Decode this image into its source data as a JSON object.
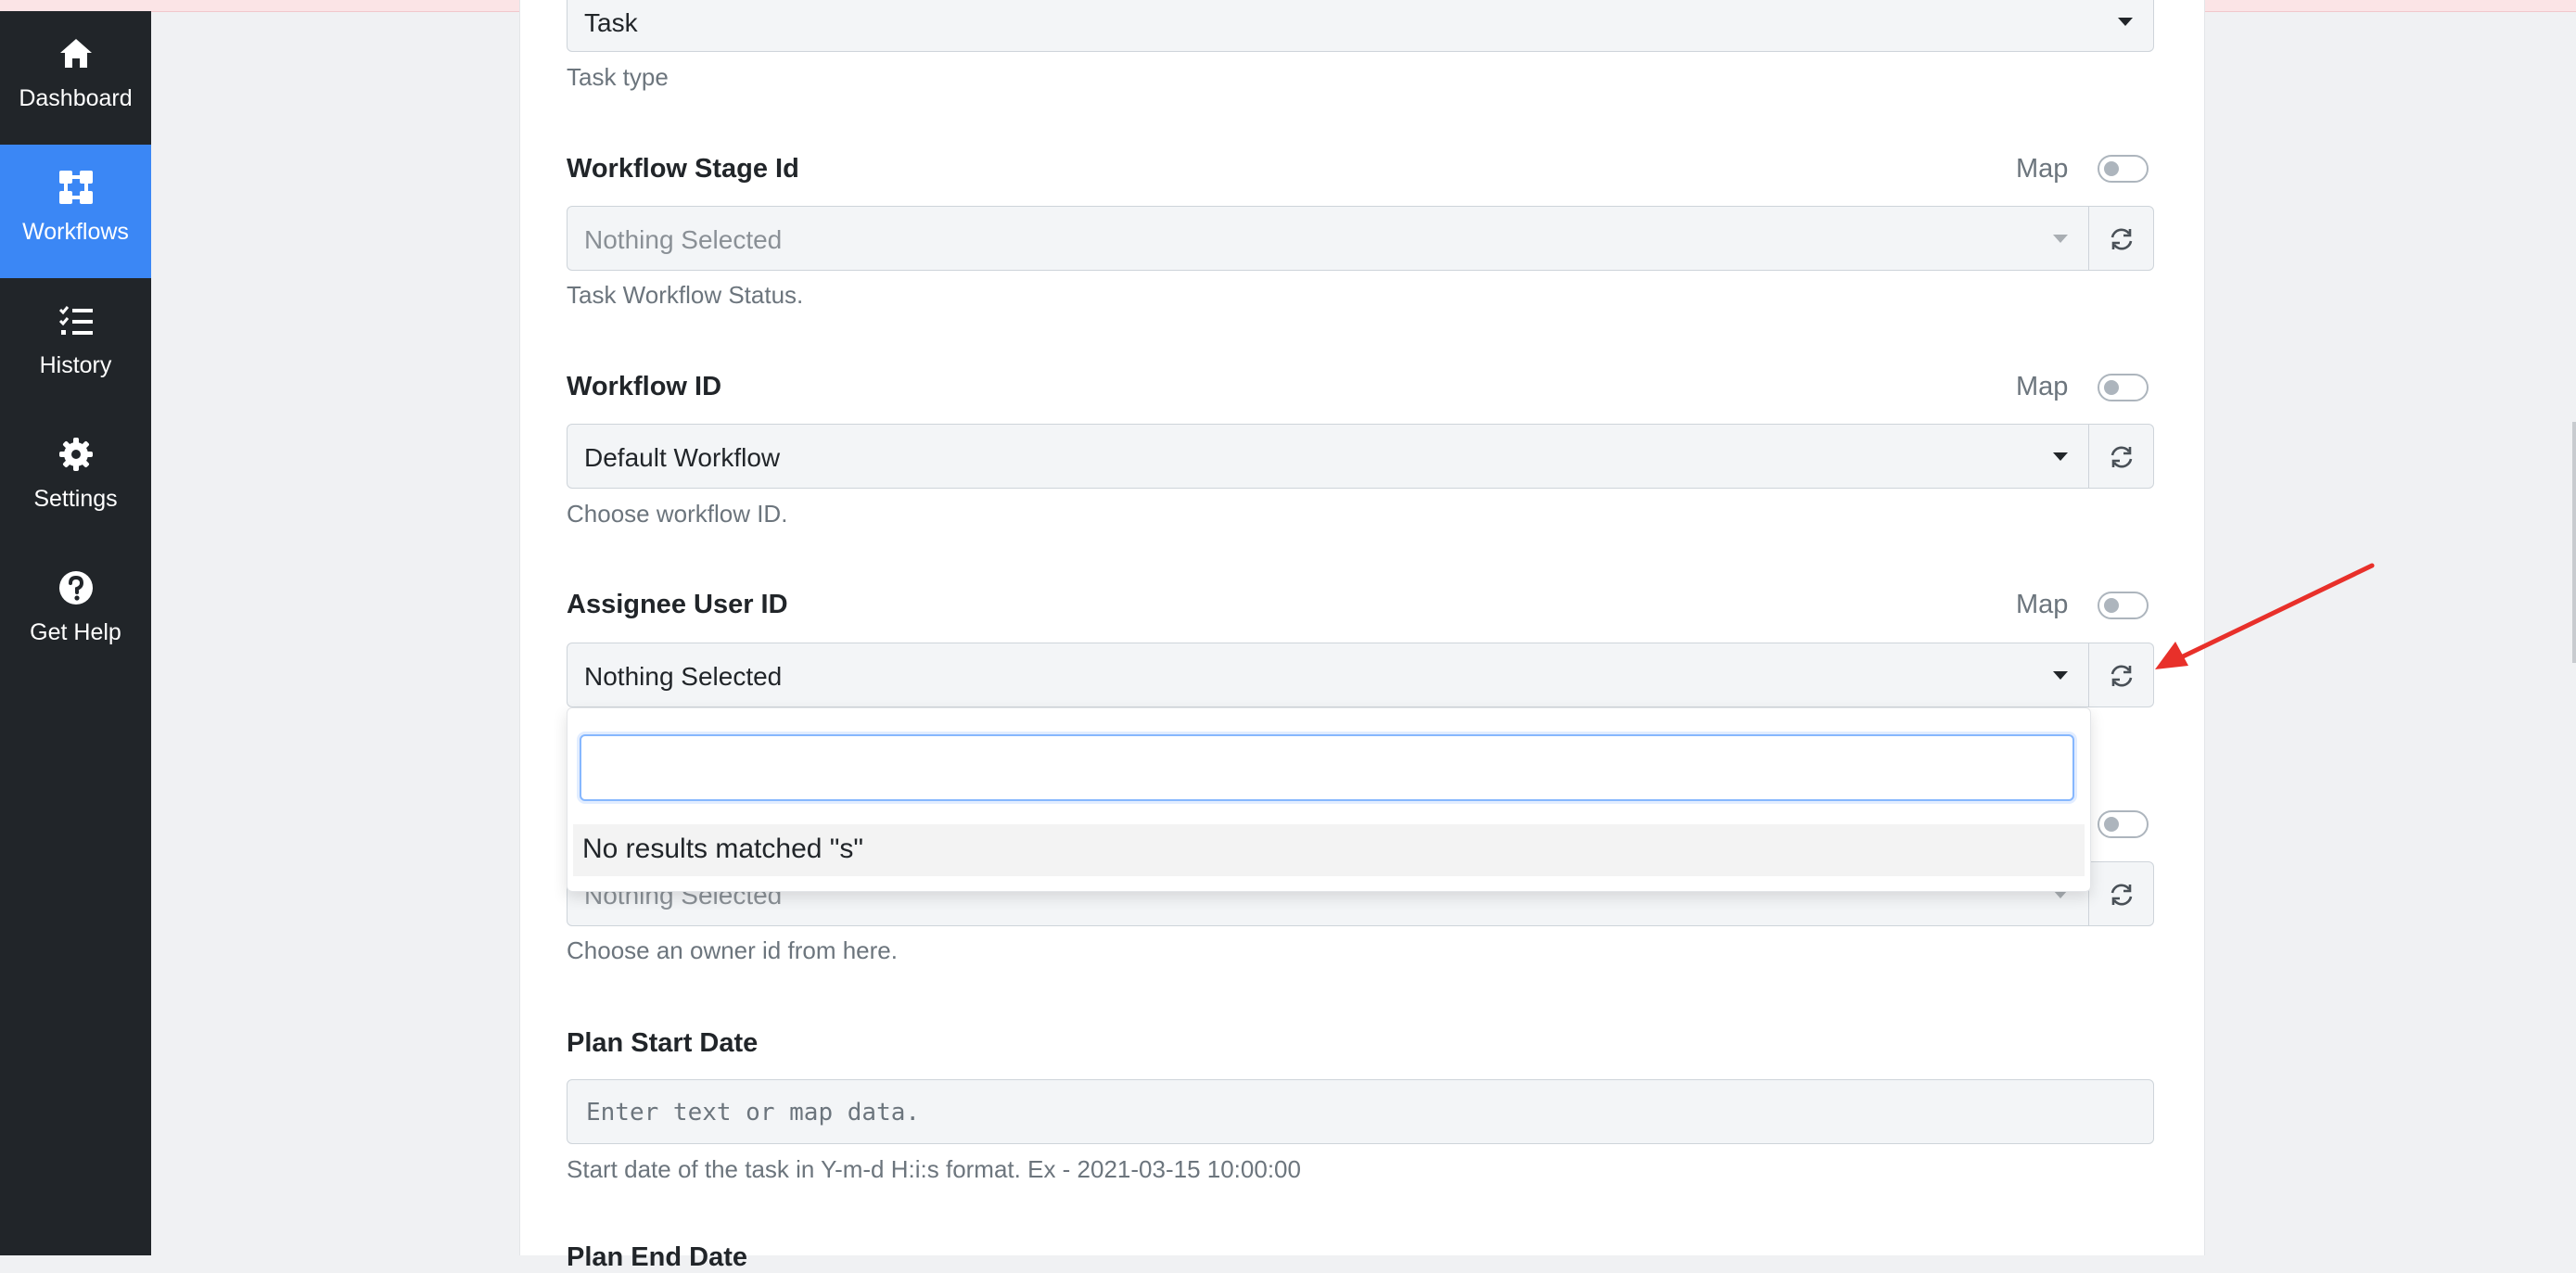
{
  "sidebar": {
    "items": [
      {
        "label": "Dashboard",
        "icon": "home-icon",
        "active": false
      },
      {
        "label": "Workflows",
        "icon": "workflow-icon",
        "active": true
      },
      {
        "label": "History",
        "icon": "checklist-icon",
        "active": false
      },
      {
        "label": "Settings",
        "icon": "gear-icon",
        "active": false
      },
      {
        "label": "Get Help",
        "icon": "question-circle-icon",
        "active": false
      }
    ]
  },
  "form": {
    "task_type": {
      "value": "Task",
      "help": "Task type"
    },
    "workflow_stage": {
      "label": "Workflow Stage Id",
      "map_label": "Map",
      "value": "Nothing Selected",
      "help": "Task Workflow Status."
    },
    "workflow_id": {
      "label": "Workflow ID",
      "map_label": "Map",
      "value": "Default Workflow",
      "help": "Choose workflow ID."
    },
    "assignee": {
      "label": "Assignee User ID",
      "map_label": "Map",
      "value": "Nothing Selected",
      "search_value": "",
      "no_results": "No results matched \"s\""
    },
    "owner": {
      "value": "Nothing Selected",
      "help": "Choose an owner id from here."
    },
    "plan_start": {
      "label": "Plan Start Date",
      "placeholder": "Enter text or map data.",
      "help": "Start date of the task in Y-m-d H:i:s format. Ex - 2021-03-15 10:00:00"
    },
    "plan_end": {
      "label": "Plan End Date"
    }
  },
  "colors": {
    "sidebar_bg": "#212529",
    "active_nav": "#3b87f5",
    "arrow": "#e8302a"
  }
}
